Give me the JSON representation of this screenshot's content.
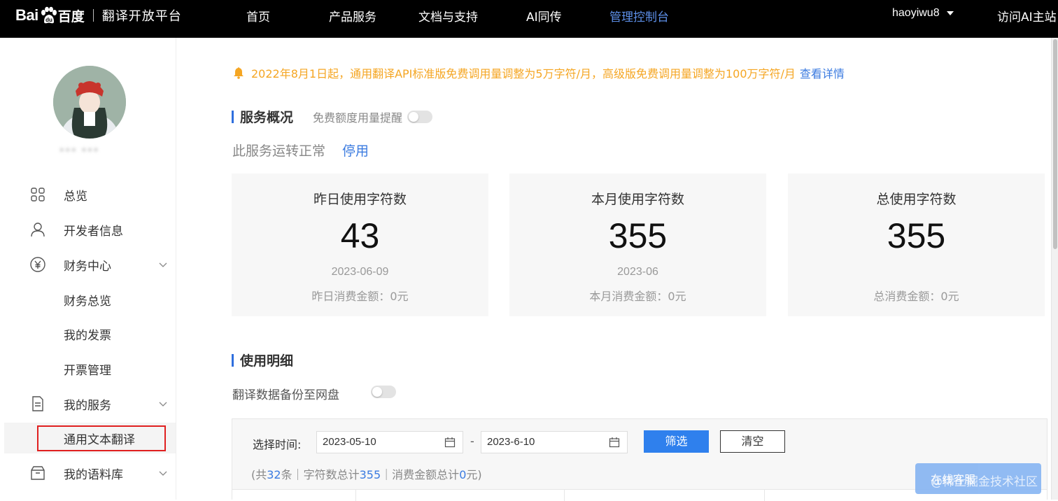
{
  "logo": {
    "bai": "Bai",
    "du_cn": "百度",
    "platform": "翻译开放平台"
  },
  "nav": {
    "items": [
      {
        "label": "首页"
      },
      {
        "label": "产品服务"
      },
      {
        "label": "文档与支持"
      },
      {
        "label": "AI同传"
      },
      {
        "label": "管理控制台"
      }
    ],
    "user": "haoyiwu8",
    "visit": "访问AI主站"
  },
  "sidebar": {
    "username": "*** ***",
    "items": [
      {
        "label": "总览",
        "icon": "grid-icon"
      },
      {
        "label": "开发者信息",
        "icon": "user-icon"
      },
      {
        "label": "财务中心",
        "icon": "yen-icon"
      },
      {
        "label": "财务总览"
      },
      {
        "label": "我的发票"
      },
      {
        "label": "开票管理"
      },
      {
        "label": "我的服务",
        "icon": "document-icon"
      },
      {
        "label": "通用文本翻译"
      },
      {
        "label": "我的语料库",
        "icon": "box-icon"
      }
    ]
  },
  "notice": {
    "text": "2022年8月1日起，通用翻译API标准版免费调用量调整为5万字符/月，高级版免费调用量调整为100万字符/月",
    "link": "查看详情"
  },
  "overview": {
    "title": "服务概况",
    "free_remind": "免费额度用量提醒",
    "status": "此服务运转正常",
    "stop": "停用"
  },
  "cards": [
    {
      "title": "昨日使用字符数",
      "value": "43",
      "date": "2023-06-09",
      "amount": "昨日消费金额：0元"
    },
    {
      "title": "本月使用字符数",
      "value": "355",
      "date": "2023-06",
      "amount": "本月消费金额：0元"
    },
    {
      "title": "总使用字符数",
      "value": "355",
      "date": "",
      "amount": "总消费金额：0元"
    }
  ],
  "detail": {
    "title": "使用明细",
    "backup": "翻译数据备份至网盘",
    "time_label": "选择时间:",
    "start_date": "2023-05-10",
    "end_date": "2023-6-10",
    "dash": "-",
    "filter_btn": "筛选",
    "clear_btn": "清空",
    "summary": {
      "p1": "(共",
      "count": "32",
      "p2": "条｜字符数总计",
      "chars": "355",
      "p3": "｜消费金额总计",
      "money": "0",
      "p4": "元)"
    }
  },
  "floating": {
    "label": "在线客服"
  },
  "watermark": "@稀土掘金技术社区"
}
